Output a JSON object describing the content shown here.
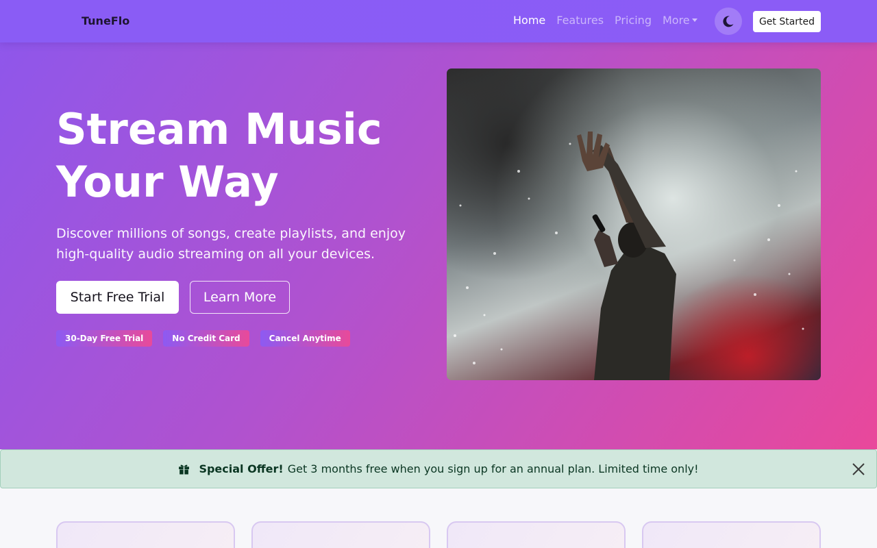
{
  "navbar": {
    "brand": "TuneFlo",
    "links": [
      {
        "label": "Home",
        "active": true
      },
      {
        "label": "Features",
        "active": false
      },
      {
        "label": "Pricing",
        "active": false
      },
      {
        "label": "More",
        "active": false
      }
    ],
    "theme_icon": "moon-icon",
    "cta_label": "Get Started"
  },
  "hero": {
    "title_line1": "Stream Music",
    "title_line2": "Your Way",
    "subtitle": "Discover millions of songs, create playlists, and enjoy high-quality audio streaming on all your devices.",
    "primary_button": "Start Free Trial",
    "secondary_button": "Learn More",
    "badges": [
      "30-Day Free Trial",
      "No Credit Card",
      "Cancel Anytime"
    ],
    "image_icon": "concert-singer-image"
  },
  "alert": {
    "icon": "gift-icon",
    "strong": "Special Offer!",
    "text": "Get 3 months free when you sign up for an annual plan. Limited time only!",
    "close_icon": "close-icon"
  },
  "colors": {
    "nav_bg": "#8b5cf6",
    "hero_start": "#8d57ec",
    "hero_end": "#e9489b",
    "alert_bg": "#d1e7dd",
    "alert_text": "#0a3622"
  }
}
